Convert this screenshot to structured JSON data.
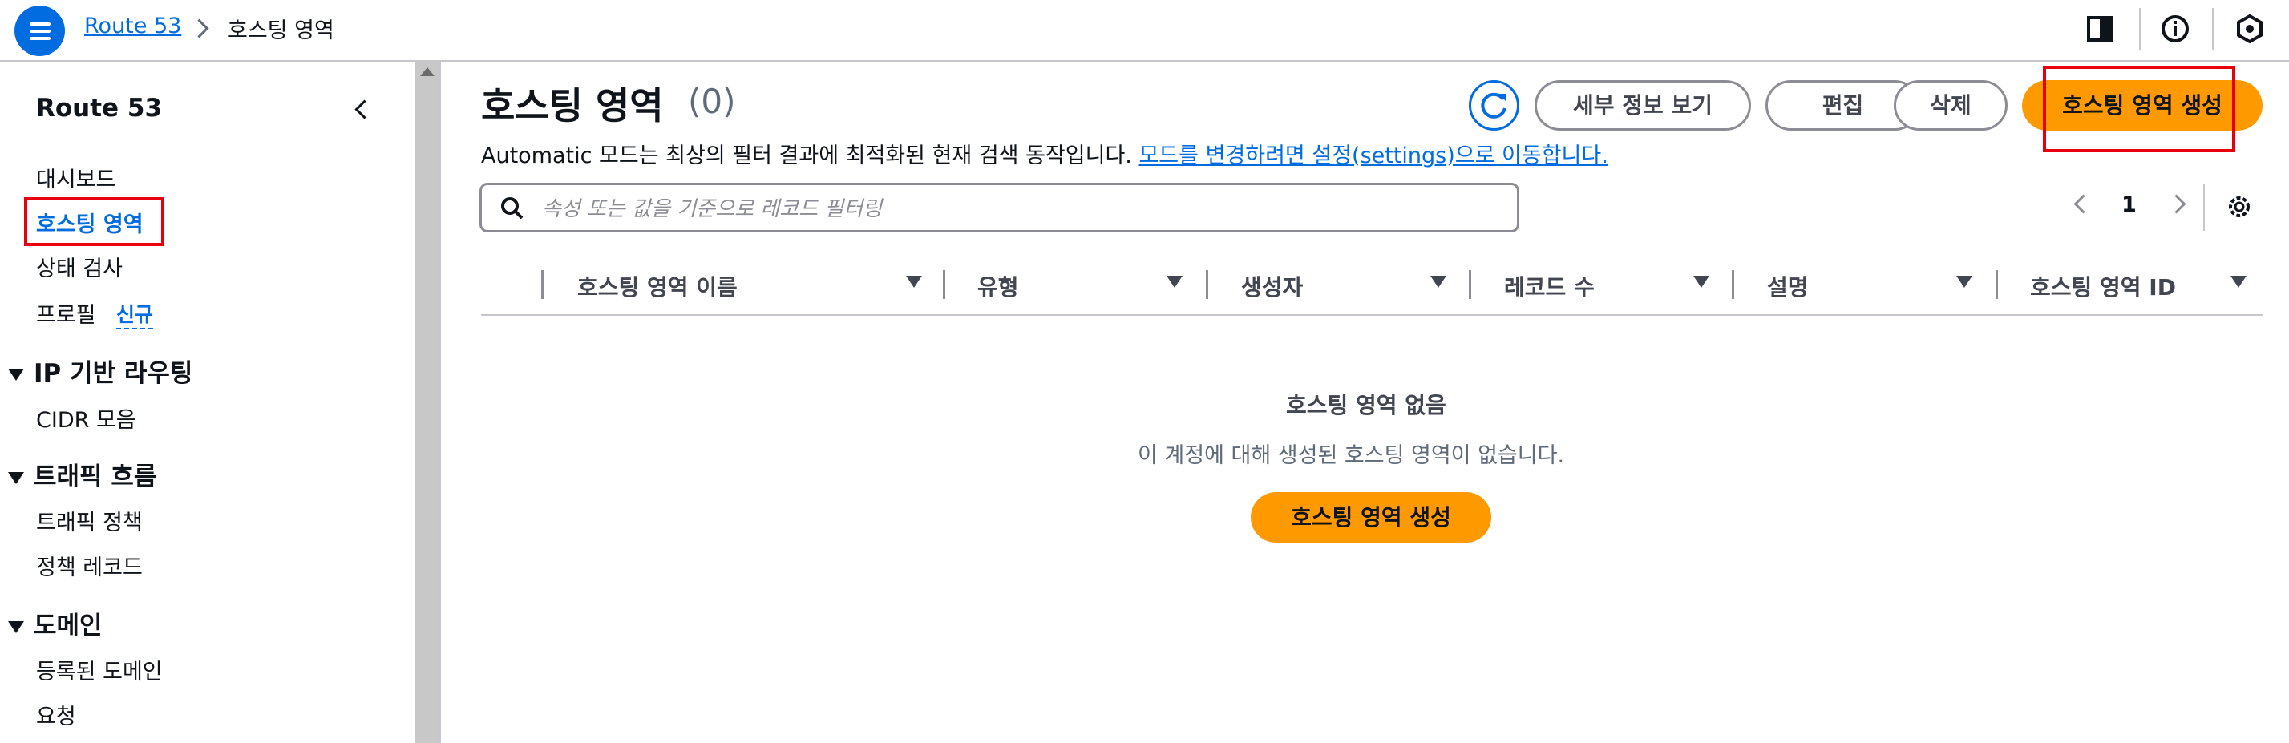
{
  "breadcrumb": {
    "service": "Route 53",
    "current": "호스팅 영역"
  },
  "topbar_icons": [
    "panel-icon",
    "info-icon",
    "hexagon-settings-icon"
  ],
  "sidenav": {
    "title": "Route 53",
    "items_top": [
      {
        "label": "대시보드"
      },
      {
        "label": "호스팅 영역",
        "active": true
      },
      {
        "label": "상태 검사"
      },
      {
        "label": "프로필",
        "badge": "신규"
      }
    ],
    "sections": [
      {
        "label": "IP 기반 라우팅",
        "items": [
          "CIDR 모음"
        ]
      },
      {
        "label": "트래픽 흐름",
        "items": [
          "트래픽 정책",
          "정책 레코드"
        ]
      },
      {
        "label": "도메인",
        "items": [
          "등록된 도메인",
          "요청"
        ]
      }
    ]
  },
  "main": {
    "title": "호스팅 영역",
    "count": "(0)",
    "info_text": "Automatic 모드는 최상의 필터 결과에 최적화된 현재 검색 동작입니다.",
    "info_link": "모드를 변경하려면 설정(settings)으로 이동합니다.",
    "buttons": {
      "details": "세부 정보 보기",
      "edit": "편집",
      "delete": "삭제",
      "create": "호스팅 영역 생성"
    },
    "search_placeholder": "속성 또는 값을 기준으로 레코드 필터링",
    "page": "1",
    "columns": [
      "호스팅 영역 이름",
      "유형",
      "생성자",
      "레코드 수",
      "설명",
      "호스팅 영역 ID"
    ],
    "empty": {
      "title": "호스팅 영역 없음",
      "description": "이 계정에 대해 생성된 호스팅 영역이 없습니다.",
      "button": "호스팅 영역 생성"
    }
  },
  "colors": {
    "accent": "#006ce0",
    "primary_button": "#ff9900",
    "highlight": "#e7000b"
  }
}
